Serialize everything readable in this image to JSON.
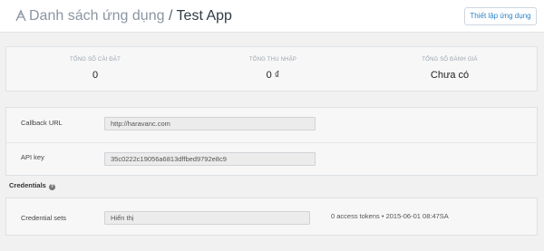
{
  "header": {
    "breadcrumb": "Danh sách ứng dụng",
    "separator": "/",
    "app_name": "Test App",
    "setup_button": "Thiết lập ứng dụng"
  },
  "stats": [
    {
      "label": "TỔNG SỐ CÀI ĐẶT",
      "value": "0"
    },
    {
      "label": "TỔNG THU NHẬP",
      "value": "0 ₫"
    },
    {
      "label": "TỔNG SỐ ĐÁNH GIÁ",
      "value": "Chưa có"
    }
  ],
  "keys": {
    "callback_label": "Callback URL",
    "callback_value": "http://haravanc.com",
    "api_label": "API key",
    "api_value": "35c0222c19056a6813dffbed9792e8c9"
  },
  "credentials": {
    "title": "Credentials",
    "help_glyph": "?",
    "sets_label": "Credential sets",
    "sets_value": "Hiển thị",
    "token_info": "0 access tokens • 2015-06-01 08:47SA"
  },
  "colors": {
    "accent": "#2a83c9",
    "background": "#f1f1f1"
  }
}
